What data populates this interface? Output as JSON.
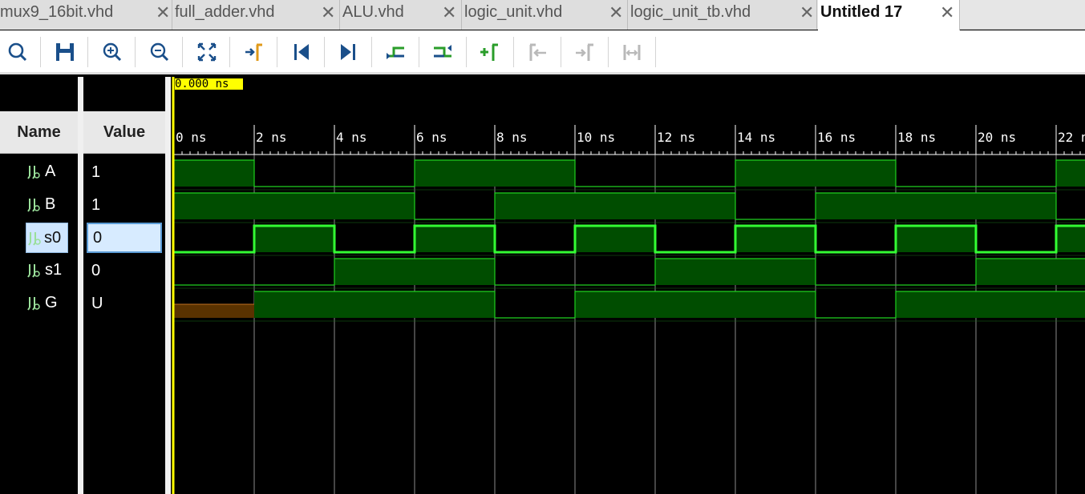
{
  "tabs": [
    {
      "label": "mux9_16bit.vhd",
      "active": false
    },
    {
      "label": "full_adder.vhd",
      "active": false
    },
    {
      "label": "ALU.vhd",
      "active": false
    },
    {
      "label": "logic_unit.vhd",
      "active": false
    },
    {
      "label": "logic_unit_tb.vhd",
      "active": false
    },
    {
      "label": "Untitled 17",
      "active": true
    }
  ],
  "close_glyph": "✕",
  "toolbar": {
    "buttons": [
      "search-icon",
      "save-icon",
      "zoom-in-icon",
      "zoom-out-icon",
      "zoom-fit-icon",
      "go-to-cursor-icon",
      "go-to-start-icon",
      "go-to-end-icon",
      "previous-transition-icon",
      "next-transition-icon",
      "add-marker-icon",
      "previous-marker-icon",
      "next-marker-icon",
      "swap-cursors-icon"
    ]
  },
  "columns": {
    "name": "Name",
    "value": "Value"
  },
  "signals": [
    {
      "name": "A",
      "value": "1"
    },
    {
      "name": "B",
      "value": "1"
    },
    {
      "name": "s0",
      "value": "0",
      "selected": true
    },
    {
      "name": "s1",
      "value": "0"
    },
    {
      "name": "G",
      "value": "U"
    }
  ],
  "cursor": {
    "time_label": "0.000 ns"
  },
  "time_axis": {
    "unit": "ns",
    "tick_labels": [
      "0 ns",
      "2 ns",
      "4 ns",
      "6 ns",
      "8 ns",
      "10 ns",
      "12 ns",
      "14 ns",
      "16 ns",
      "18 ns",
      "20 ns",
      "22 ns"
    ]
  },
  "waveforms": {
    "period_ns": 2,
    "A": [
      "1",
      "0",
      "0",
      "1",
      "1",
      "0",
      "0",
      "1",
      "1",
      "0",
      "0",
      "1"
    ],
    "B": [
      "1",
      "1",
      "1",
      "0",
      "1",
      "1",
      "1",
      "0",
      "1",
      "1",
      "1",
      "0"
    ],
    "s0": [
      "0",
      "1",
      "0",
      "1",
      "0",
      "1",
      "0",
      "1",
      "0",
      "1",
      "0",
      "1"
    ],
    "s1": [
      "0",
      "0",
      "1",
      "1",
      "0",
      "0",
      "1",
      "1",
      "0",
      "0",
      "1",
      "1"
    ],
    "G": [
      "U",
      "1",
      "1",
      "1",
      "0",
      "1",
      "1",
      "1",
      "0",
      "1",
      "1",
      "1"
    ]
  },
  "colors": {
    "wave_high": "#004d00",
    "wave_line": "#1fcf1f",
    "wave_bright": "#33ff33",
    "undefined": "#5a3200",
    "cursor": "#ffff00"
  }
}
